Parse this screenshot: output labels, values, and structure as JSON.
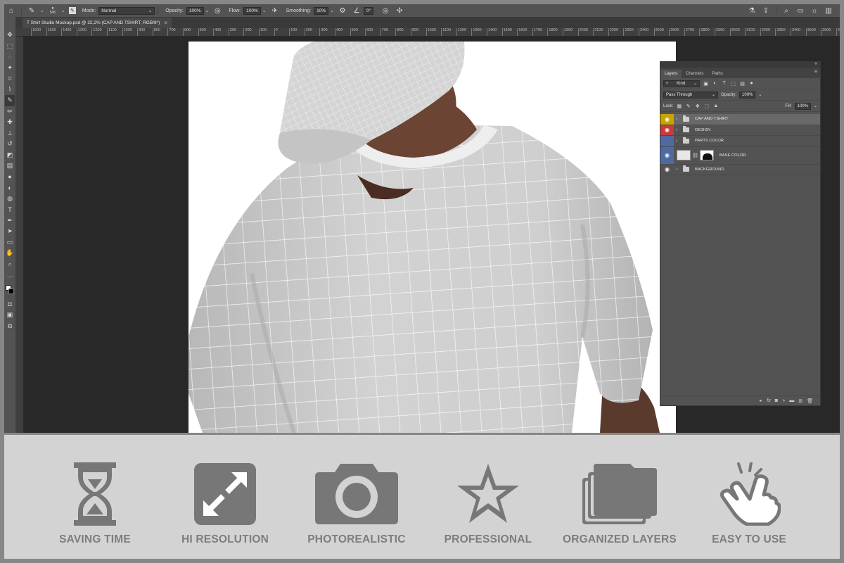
{
  "options_bar": {
    "brush_size": "545",
    "mode_label": "Mode:",
    "mode_value": "Normal",
    "opacity_label": "Opacity:",
    "opacity_value": "100%",
    "flow_label": "Flow:",
    "flow_value": "100%",
    "smoothing_label": "Smoothing:",
    "smoothing_value": "10%",
    "angle_value": "0°"
  },
  "document_tab": {
    "title": "T Shirt Studio Mockup.psd @ 22,2% (CAP AND TSHIRT, RGB/8*)",
    "close": "×"
  },
  "ruler": {
    "ticks": [
      "1600",
      "1500",
      "1400",
      "1300",
      "1200",
      "1100",
      "1000",
      "900",
      "800",
      "700",
      "600",
      "500",
      "400",
      "300",
      "200",
      "100",
      "0",
      "100",
      "200",
      "300",
      "400",
      "500",
      "600",
      "700",
      "800",
      "900",
      "1000",
      "1100",
      "1200",
      "1300",
      "1400",
      "1500",
      "1600",
      "1700",
      "1800",
      "1900",
      "2000",
      "2100",
      "2200",
      "2300",
      "2400",
      "2500",
      "2600",
      "2700",
      "2800",
      "2900",
      "3000",
      "3100",
      "3200",
      "3300",
      "3400",
      "3500",
      "3600",
      "3700",
      "3800",
      "3900",
      "4000",
      "4100",
      "4200",
      "4300",
      "4400",
      "4500",
      "4600",
      "4700"
    ]
  },
  "layers_panel": {
    "tabs": [
      "Layers",
      "Channels",
      "Paths"
    ],
    "filter_label": "Kind",
    "blend_mode": "Pass Through",
    "opacity_label": "Opacity:",
    "opacity_value": "100%",
    "lock_label": "Lock:",
    "fill_label": "Fill:",
    "fill_value": "100%",
    "layers": [
      {
        "name": "CAP AND TSHIRT",
        "color": "#c9a400",
        "type": "group",
        "selected": true
      },
      {
        "name": "DESIGN",
        "color": "#c93a3a",
        "type": "group",
        "selected": false
      },
      {
        "name": "PARTS COLOR",
        "color": "#4e6aa0",
        "type": "group",
        "selected": false
      },
      {
        "name": "BASE COLOR",
        "color": "#4e6aa0",
        "type": "layer",
        "selected": false
      },
      {
        "name": "BACKGROUND",
        "color": "#535353",
        "type": "group",
        "selected": false
      }
    ]
  },
  "features": [
    {
      "label": "SAVING TIME",
      "icon": "hourglass-icon"
    },
    {
      "label": "HI RESOLUTION",
      "icon": "expand-arrows-icon"
    },
    {
      "label": "PHOTOREALISTIC",
      "icon": "camera-icon"
    },
    {
      "label": "PROFESSIONAL",
      "icon": "star-icon"
    },
    {
      "label": "ORGANIZED LAYERS",
      "icon": "stacked-folders-icon"
    },
    {
      "label": "EASY TO USE",
      "icon": "tap-hand-icon"
    }
  ],
  "colors": {
    "feature_icon": "#777777",
    "feature_text": "#7d7d7d",
    "feature_bg": "#d3d3d3"
  }
}
